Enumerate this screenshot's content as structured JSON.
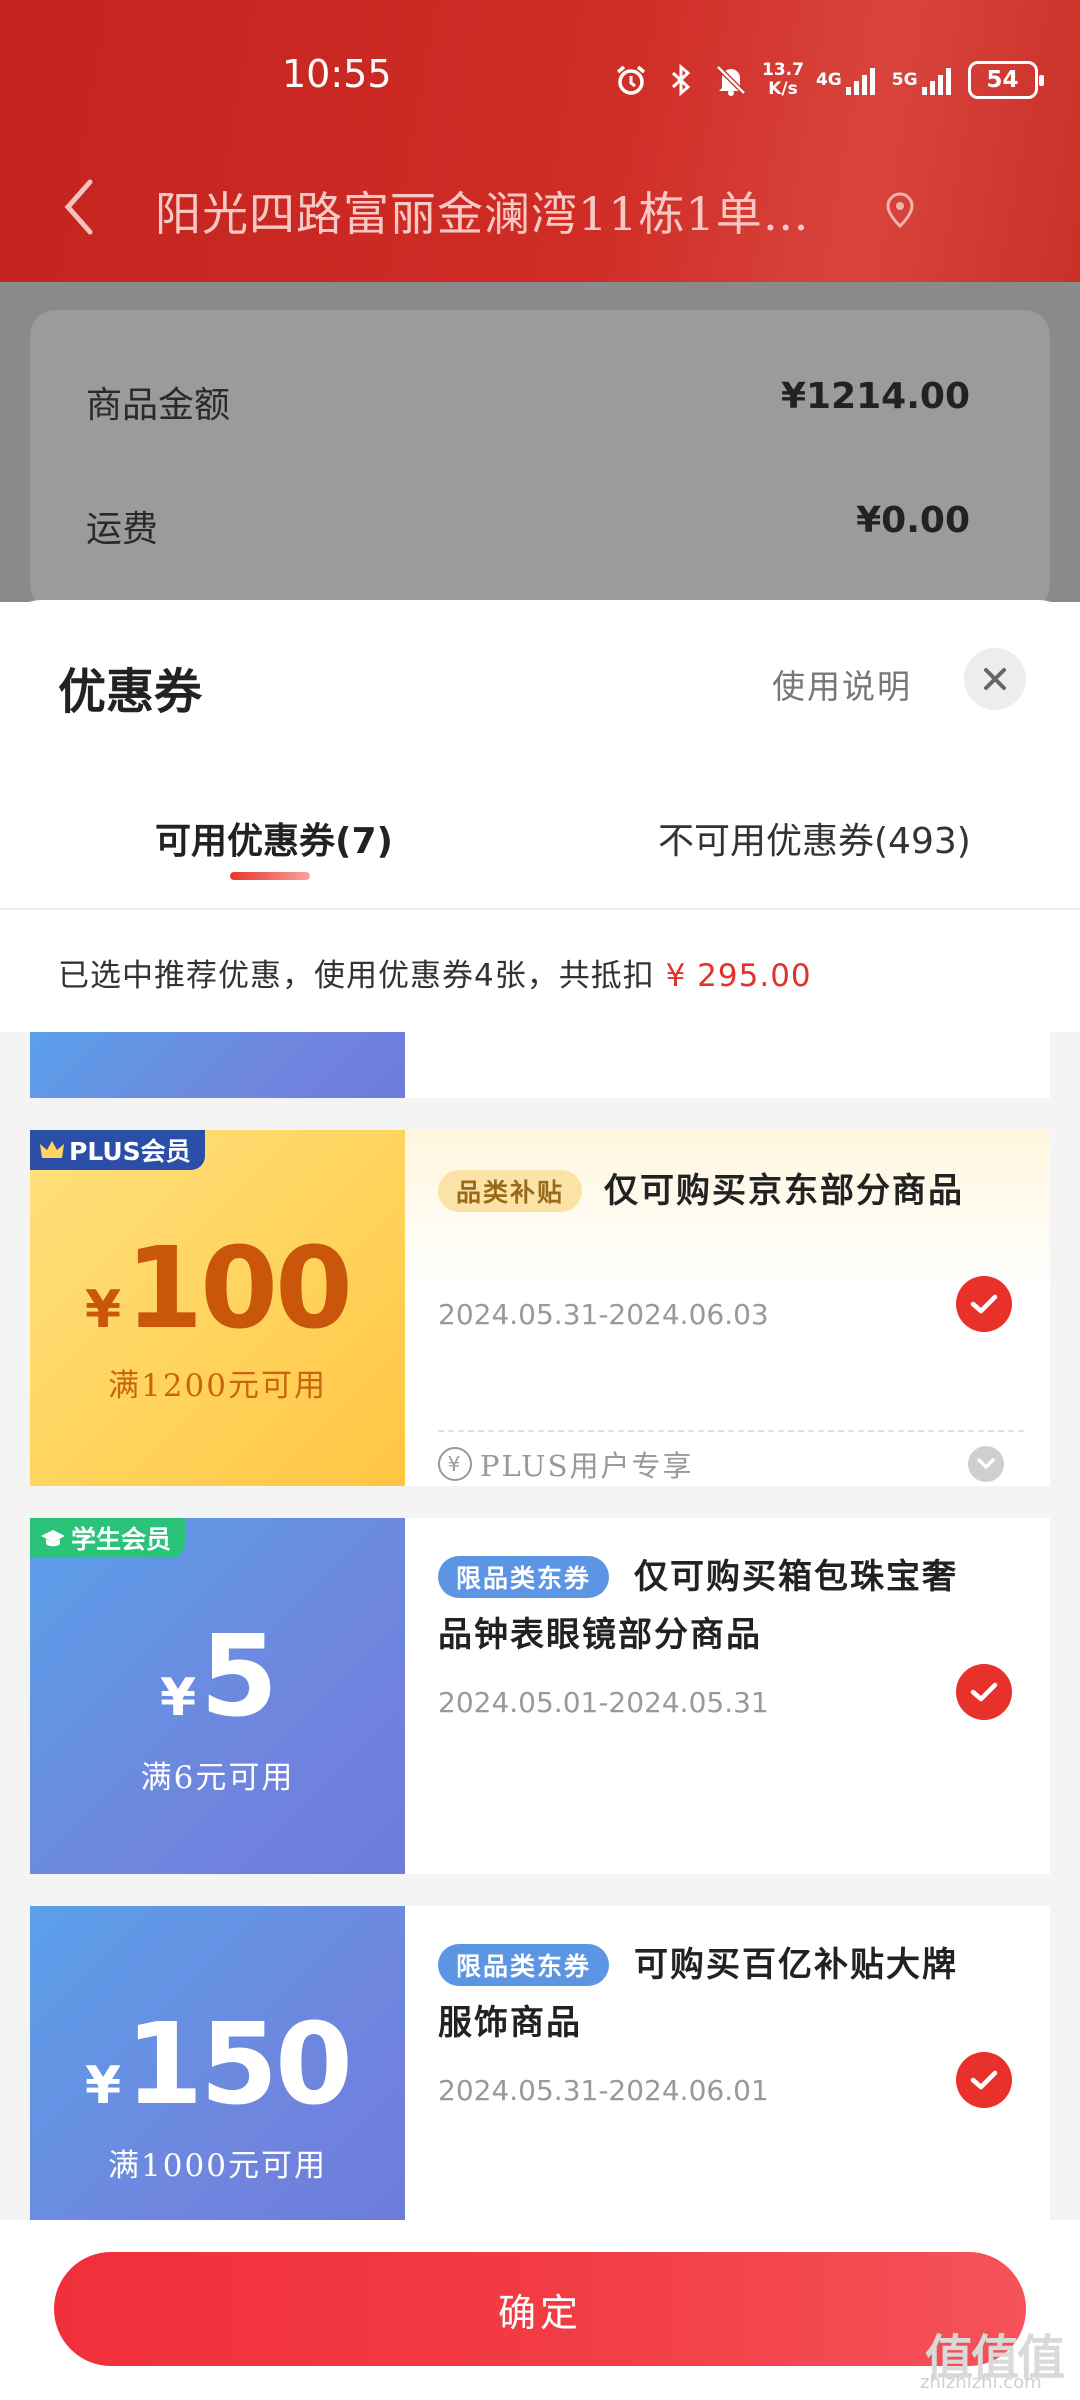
{
  "status_bar": {
    "time": "10:55",
    "net_speed_top": "13.7",
    "net_speed_bottom": "K/s",
    "net_4g": "4G",
    "net_5g": "5G",
    "battery": "54"
  },
  "nav": {
    "address": "阳光四路富丽金澜湾11栋1单…"
  },
  "order_summary": {
    "rows": [
      {
        "label": "商品金额",
        "value": "¥1214.00"
      },
      {
        "label": "运费",
        "value": "¥0.00"
      }
    ]
  },
  "sheet": {
    "title": "优惠券",
    "help_label": "使用说明",
    "tabs": [
      {
        "label": "可用优惠券(7)",
        "active": true
      },
      {
        "label": "不可用优惠券(493)",
        "active": false
      }
    ],
    "recommend_text": "已选中推荐优惠，使用优惠券4张，共抵扣",
    "recommend_amount": "¥ 295.00"
  },
  "coupons": [
    {
      "badge": "PLUS会员",
      "yen": "¥",
      "amount": "100",
      "threshold": "满1200元可用",
      "tag": "品类补贴",
      "title": "仅可购买京东部分商品",
      "date": "2024.05.31-2024.06.03",
      "footer": "PLUS用户专享",
      "footer_icon": "¥",
      "selected": true
    },
    {
      "badge": "学生会员",
      "yen": "¥",
      "amount": "5",
      "threshold": "满6元可用",
      "tag": "限品类东券",
      "title_line1": "仅可购买箱包珠宝奢",
      "title_line2": "品钟表眼镜部分商品",
      "date": "2024.05.01-2024.05.31",
      "selected": true
    },
    {
      "yen": "¥",
      "amount": "150",
      "threshold": "满1000元可用",
      "tag": "限品类东券",
      "title_line1": "可购买百亿补贴大牌",
      "title_line2": "服饰商品",
      "date": "2024.05.31-2024.06.01",
      "selected": true
    }
  ],
  "confirm_label": "确定",
  "watermark": {
    "main": "值值值",
    "sub": "zhizhizhi.com"
  },
  "colors": {
    "brand_red": "#e8312b",
    "header_red": "#cf2c25",
    "coupon_blue": "#6f86de",
    "coupon_gold": "#ffd35c",
    "plus_badge": "#2b4fa8",
    "student_badge": "#2bc27a"
  }
}
